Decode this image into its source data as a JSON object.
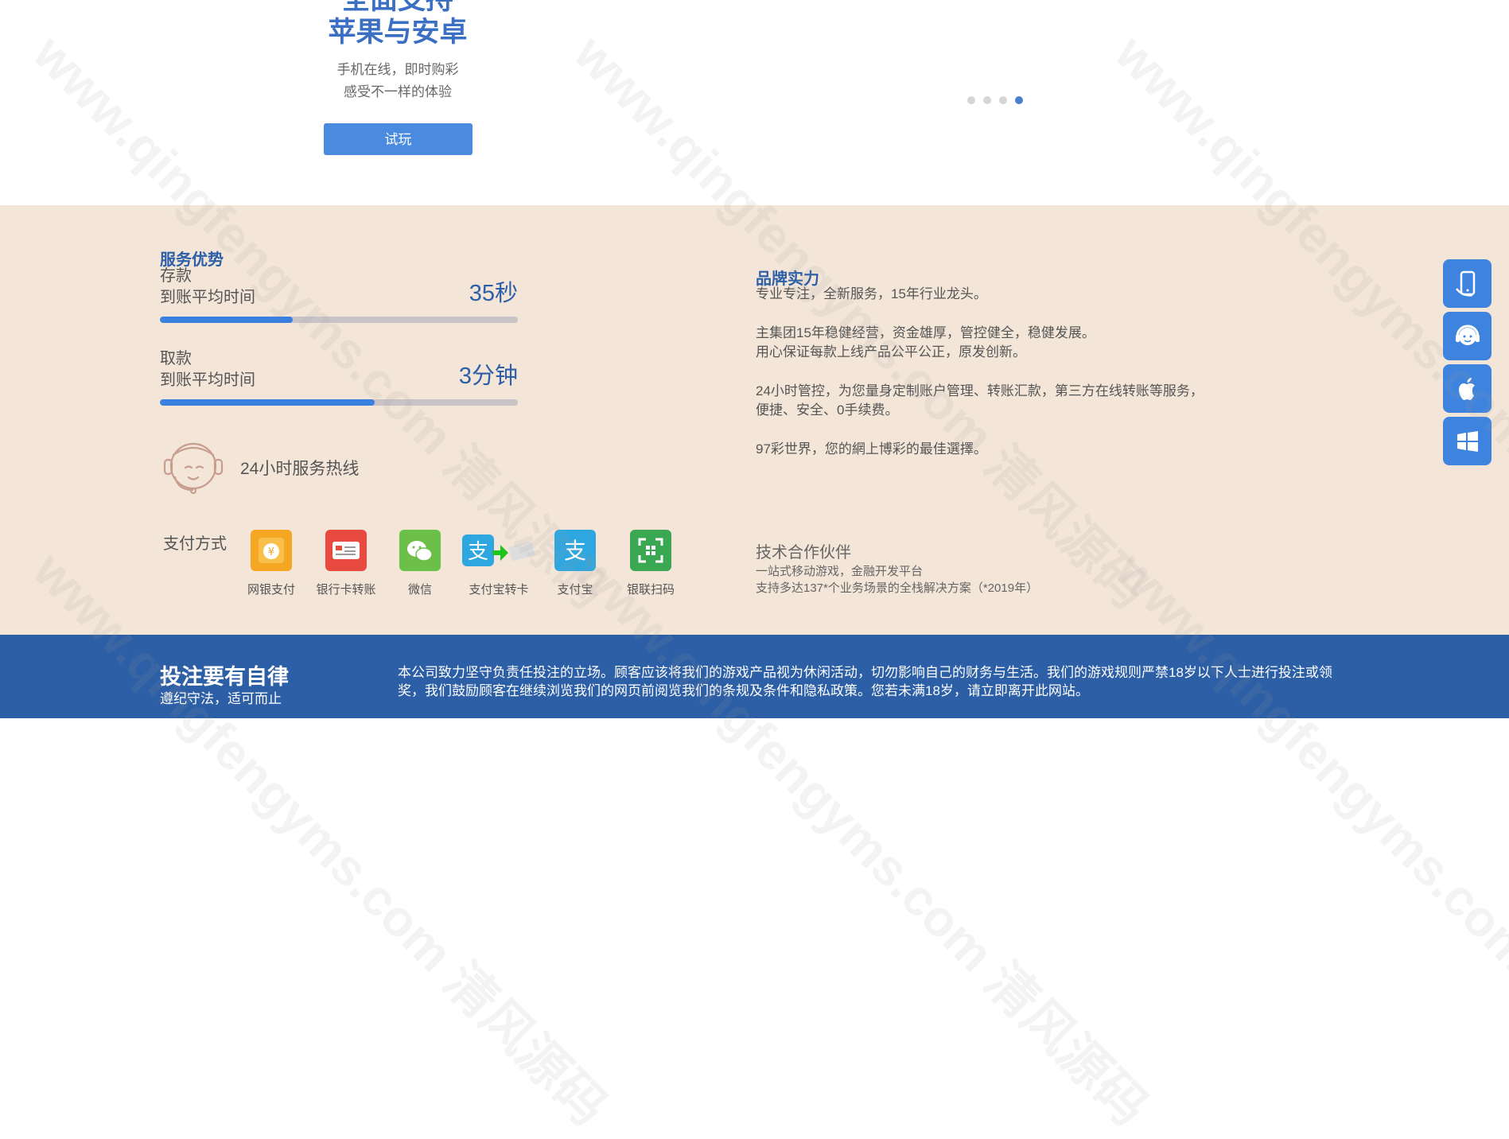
{
  "hero": {
    "title_line1": "全面支持",
    "title_line2": "苹果与安卓",
    "sub_line1": "手机在线，即时购彩",
    "sub_line2": "感受不一样的体验",
    "try_button": "试玩",
    "carousel_active_index": 4,
    "carousel_count": 4
  },
  "service": {
    "title": "服务优势",
    "deposit": {
      "label1": "存款",
      "label2": "到账平均时间",
      "value": "35秒",
      "progress": 0.37
    },
    "withdraw": {
      "label1": "取款",
      "label2": "到账平均时间",
      "value": "3分钟",
      "progress": 0.6
    },
    "hotline": "24小时服务热线"
  },
  "payment": {
    "label": "支付方式",
    "methods": [
      {
        "name": "网银支付",
        "icon": "online-bank-icon",
        "color": "#f5a623"
      },
      {
        "name": "银行卡转账",
        "icon": "bank-card-icon",
        "color": "#e84a3f"
      },
      {
        "name": "微信",
        "icon": "wechat-icon",
        "color": "#6cc04a"
      },
      {
        "name": "支付宝转卡",
        "icon": "alipay-transfer-icon",
        "color": "#2ea7e0"
      },
      {
        "name": "支付宝",
        "icon": "alipay-icon",
        "color": "#2ea7e0"
      },
      {
        "name": "银联扫码",
        "icon": "unionpay-qr-icon",
        "color": "#3aa852"
      }
    ]
  },
  "brand": {
    "title": "品牌实力",
    "p1": "专业专注，全新服务，15年行业龙头。",
    "p2a": "主集团15年稳健经营，资金雄厚，管控健全，稳健发展。",
    "p2b": "用心保证每款上线产品公平公正，原发创新。",
    "p3a": "24小时管控，为您量身定制账户管理、转账汇款，第三方在线转账等服务，",
    "p3b": "便捷、安全、0手续费。",
    "p4": "97彩世界，您的網上博彩的最佳選擇。"
  },
  "tech": {
    "title": "技术合作伙伴",
    "line1": "一站式移动游戏，金融开发平台",
    "line2": "支持多达137*个业务场景的全栈解决方案（*2019年）"
  },
  "side_buttons": [
    "mobile-icon",
    "customer-service-icon",
    "apple-icon",
    "windows-icon"
  ],
  "footer": {
    "title": "投注要有自律",
    "subtitle": "遵纪守法，适可而止",
    "text": "本公司致力坚守负责任投注的立场。顾客应该将我们的游戏产品视为休闲活动，切勿影响自己的财务与生活。我们的游戏规则严禁18岁以下人士进行投注或领奖，我们鼓励顾客在继续浏览我们的网页前阅览我们的条规及条件和隐私政策。您若未满18岁，请立即离开此网站。"
  },
  "watermark": "www.qingfengyms.com 清风源码",
  "colors": {
    "brand_blue": "#2d5fa8",
    "button_blue": "#4a8be0",
    "beige": "#f3e5d8",
    "footer_blue": "#2d5fa6"
  }
}
